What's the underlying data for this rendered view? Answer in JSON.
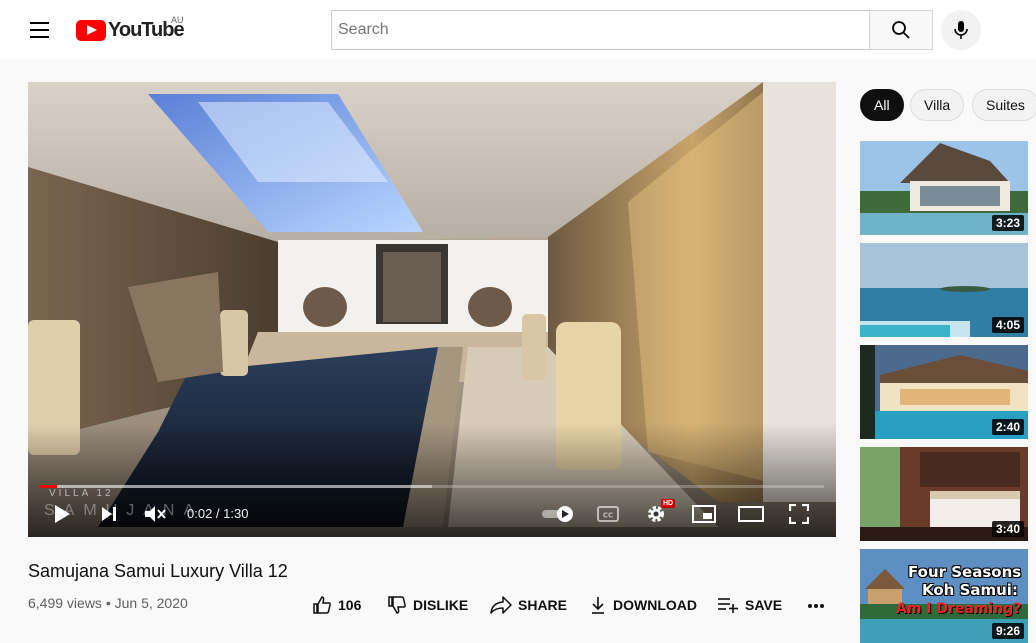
{
  "header": {
    "logo_text": "YouTube",
    "country_code": "AU",
    "search_placeholder": "Search"
  },
  "player": {
    "current_time": "0:02",
    "duration": "1:30",
    "time_display": "0:02 / 1:30",
    "progress_fraction": 0.022,
    "buffered_fraction": 0.5,
    "watermark_top": "VILLA 12",
    "watermark_brand": "SAMUJANA",
    "quality_badge": "HD",
    "icons": [
      "play-icon",
      "next-icon",
      "mute-icon",
      "autoplay-toggle-icon",
      "captions-icon",
      "settings-icon",
      "miniplayer-icon",
      "theater-icon",
      "fullscreen-icon"
    ]
  },
  "video": {
    "title": "Samujana Samui Luxury Villa 12",
    "meta": "6,499 views • Jun 5, 2020",
    "actions": {
      "like_count": "106",
      "dislike": "DISLIKE",
      "share": "SHARE",
      "download": "DOWNLOAD",
      "save": "SAVE"
    }
  },
  "sidebar": {
    "chips": [
      "All",
      "Villa",
      "Suites"
    ],
    "thumbnails": [
      {
        "duration": "3:23"
      },
      {
        "duration": "4:05"
      },
      {
        "duration": "2:40"
      },
      {
        "duration": "3:40"
      },
      {
        "duration": "9:26",
        "overlay_line1": "Four Seasons",
        "overlay_line2": "Koh Samui:",
        "overlay_line3": "Am I Dreaming?"
      }
    ]
  },
  "colors": {
    "brand_red": "#ff0000",
    "chip_active_bg": "#0f0f0f",
    "meta_text": "#606060"
  }
}
